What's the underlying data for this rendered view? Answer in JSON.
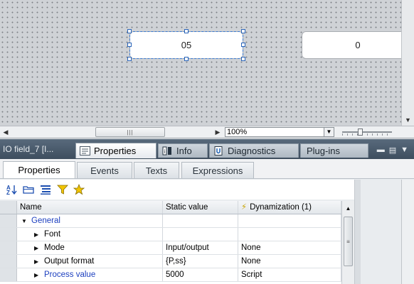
{
  "canvas": {
    "field_selected_value": "05",
    "field_second_value": "0"
  },
  "canvas_bar": {
    "zoom_value": "100%"
  },
  "inspector": {
    "object_title": "IO field_7 [I...",
    "tabs": [
      {
        "label": "Properties",
        "icon": "properties-icon"
      },
      {
        "label": "Info",
        "icon": "info-icon"
      },
      {
        "label": "Diagnostics",
        "icon": "diagnostics-icon"
      },
      {
        "label": "Plug-ins",
        "icon": ""
      }
    ]
  },
  "subtabs": [
    "Properties",
    "Events",
    "Texts",
    "Expressions"
  ],
  "toolbar": {
    "icons": [
      "sort-az-icon",
      "folder-icon",
      "list-icon",
      "filter-icon",
      "star-icon"
    ]
  },
  "table": {
    "headers": {
      "name": "Name",
      "static": "Static value",
      "dynamization": "Dynamization (1)"
    },
    "rows": [
      {
        "name": "General",
        "static": "",
        "dyn": "",
        "level": 0,
        "expanded": true
      },
      {
        "name": "Font",
        "static": "",
        "dyn": "",
        "level": 1,
        "expanded": false
      },
      {
        "name": "Mode",
        "static": "Input/output",
        "dyn": "None",
        "level": 1,
        "expanded": false
      },
      {
        "name": "Output format",
        "static": "{P,ss}",
        "dyn": "None",
        "level": 1,
        "expanded": false
      },
      {
        "name": "Process value",
        "static": "5000",
        "dyn": "Script",
        "level": 1,
        "expanded": false
      }
    ]
  },
  "colors": {
    "accent_blue": "#1c3fbf",
    "inspector_bar": "#4a5b6c",
    "dynamization_icon": "#c9a400"
  }
}
